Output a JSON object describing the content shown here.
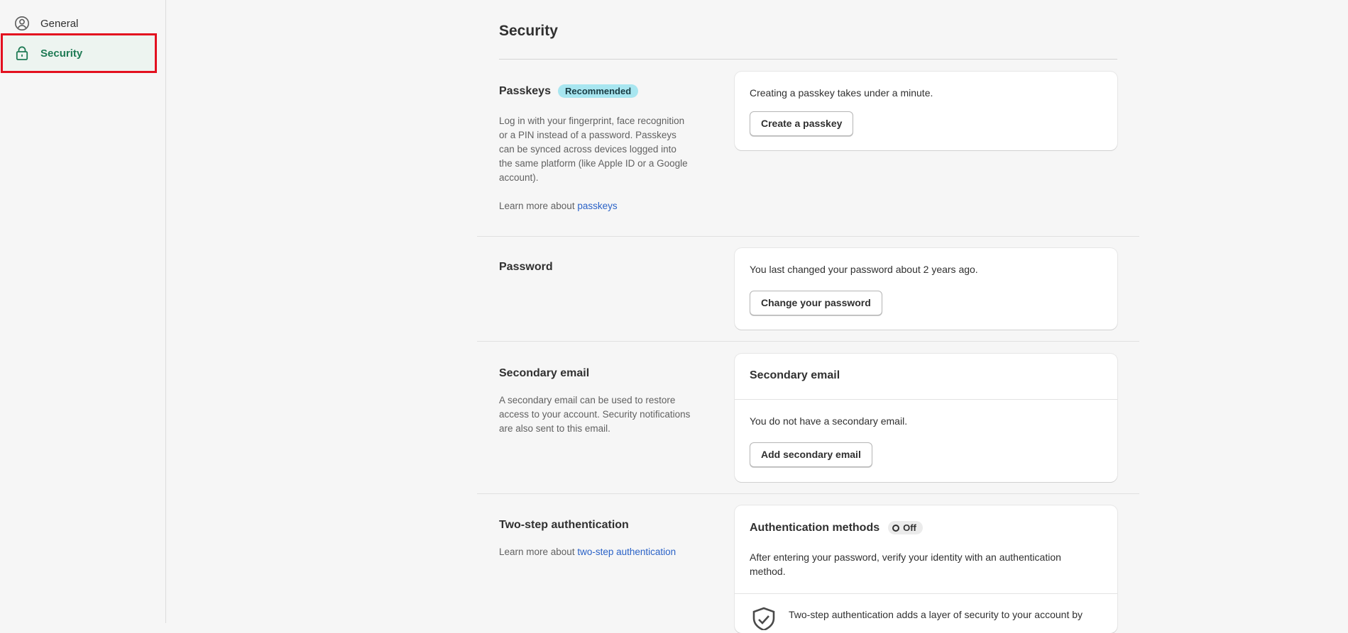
{
  "sidebar": {
    "items": [
      {
        "label": "General",
        "icon": "user-circle-icon"
      },
      {
        "label": "Security",
        "icon": "lock-icon",
        "active": true
      }
    ]
  },
  "page": {
    "title": "Security"
  },
  "passkeys": {
    "title": "Passkeys",
    "badge": "Recommended",
    "description": "Log in with your fingerprint, face recognition or a PIN instead of a password. Passkeys can be synced across devices logged into the same platform (like Apple ID or a Google account).",
    "learn_more_prefix": "Learn more about ",
    "learn_more_link": "passkeys",
    "card_text": "Creating a passkey takes under a minute.",
    "button": "Create a passkey"
  },
  "password": {
    "title": "Password",
    "card_text": "You last changed your password about 2 years ago.",
    "button": "Change your password"
  },
  "secondary_email": {
    "title": "Secondary email",
    "description": "A secondary email can be used to restore access to your account. Security notifications are also sent to this email.",
    "card_title": "Secondary email",
    "card_text": "You do not have a secondary email.",
    "button": "Add secondary email"
  },
  "two_step": {
    "title": "Two-step authentication",
    "learn_more_prefix": "Learn more about ",
    "learn_more_link": "two-step authentication",
    "card_title": "Authentication methods",
    "status": "Off",
    "card_text": "After entering your password, verify your identity with an authentication method.",
    "info_text": "Two-step authentication adds a layer of security to your account by"
  },
  "colors": {
    "accent": "#1e7a54",
    "active_bg": "#edf4f0",
    "highlight_border": "#e3101f",
    "link": "#2a62c7",
    "badge_bg": "#a8e6f0"
  }
}
